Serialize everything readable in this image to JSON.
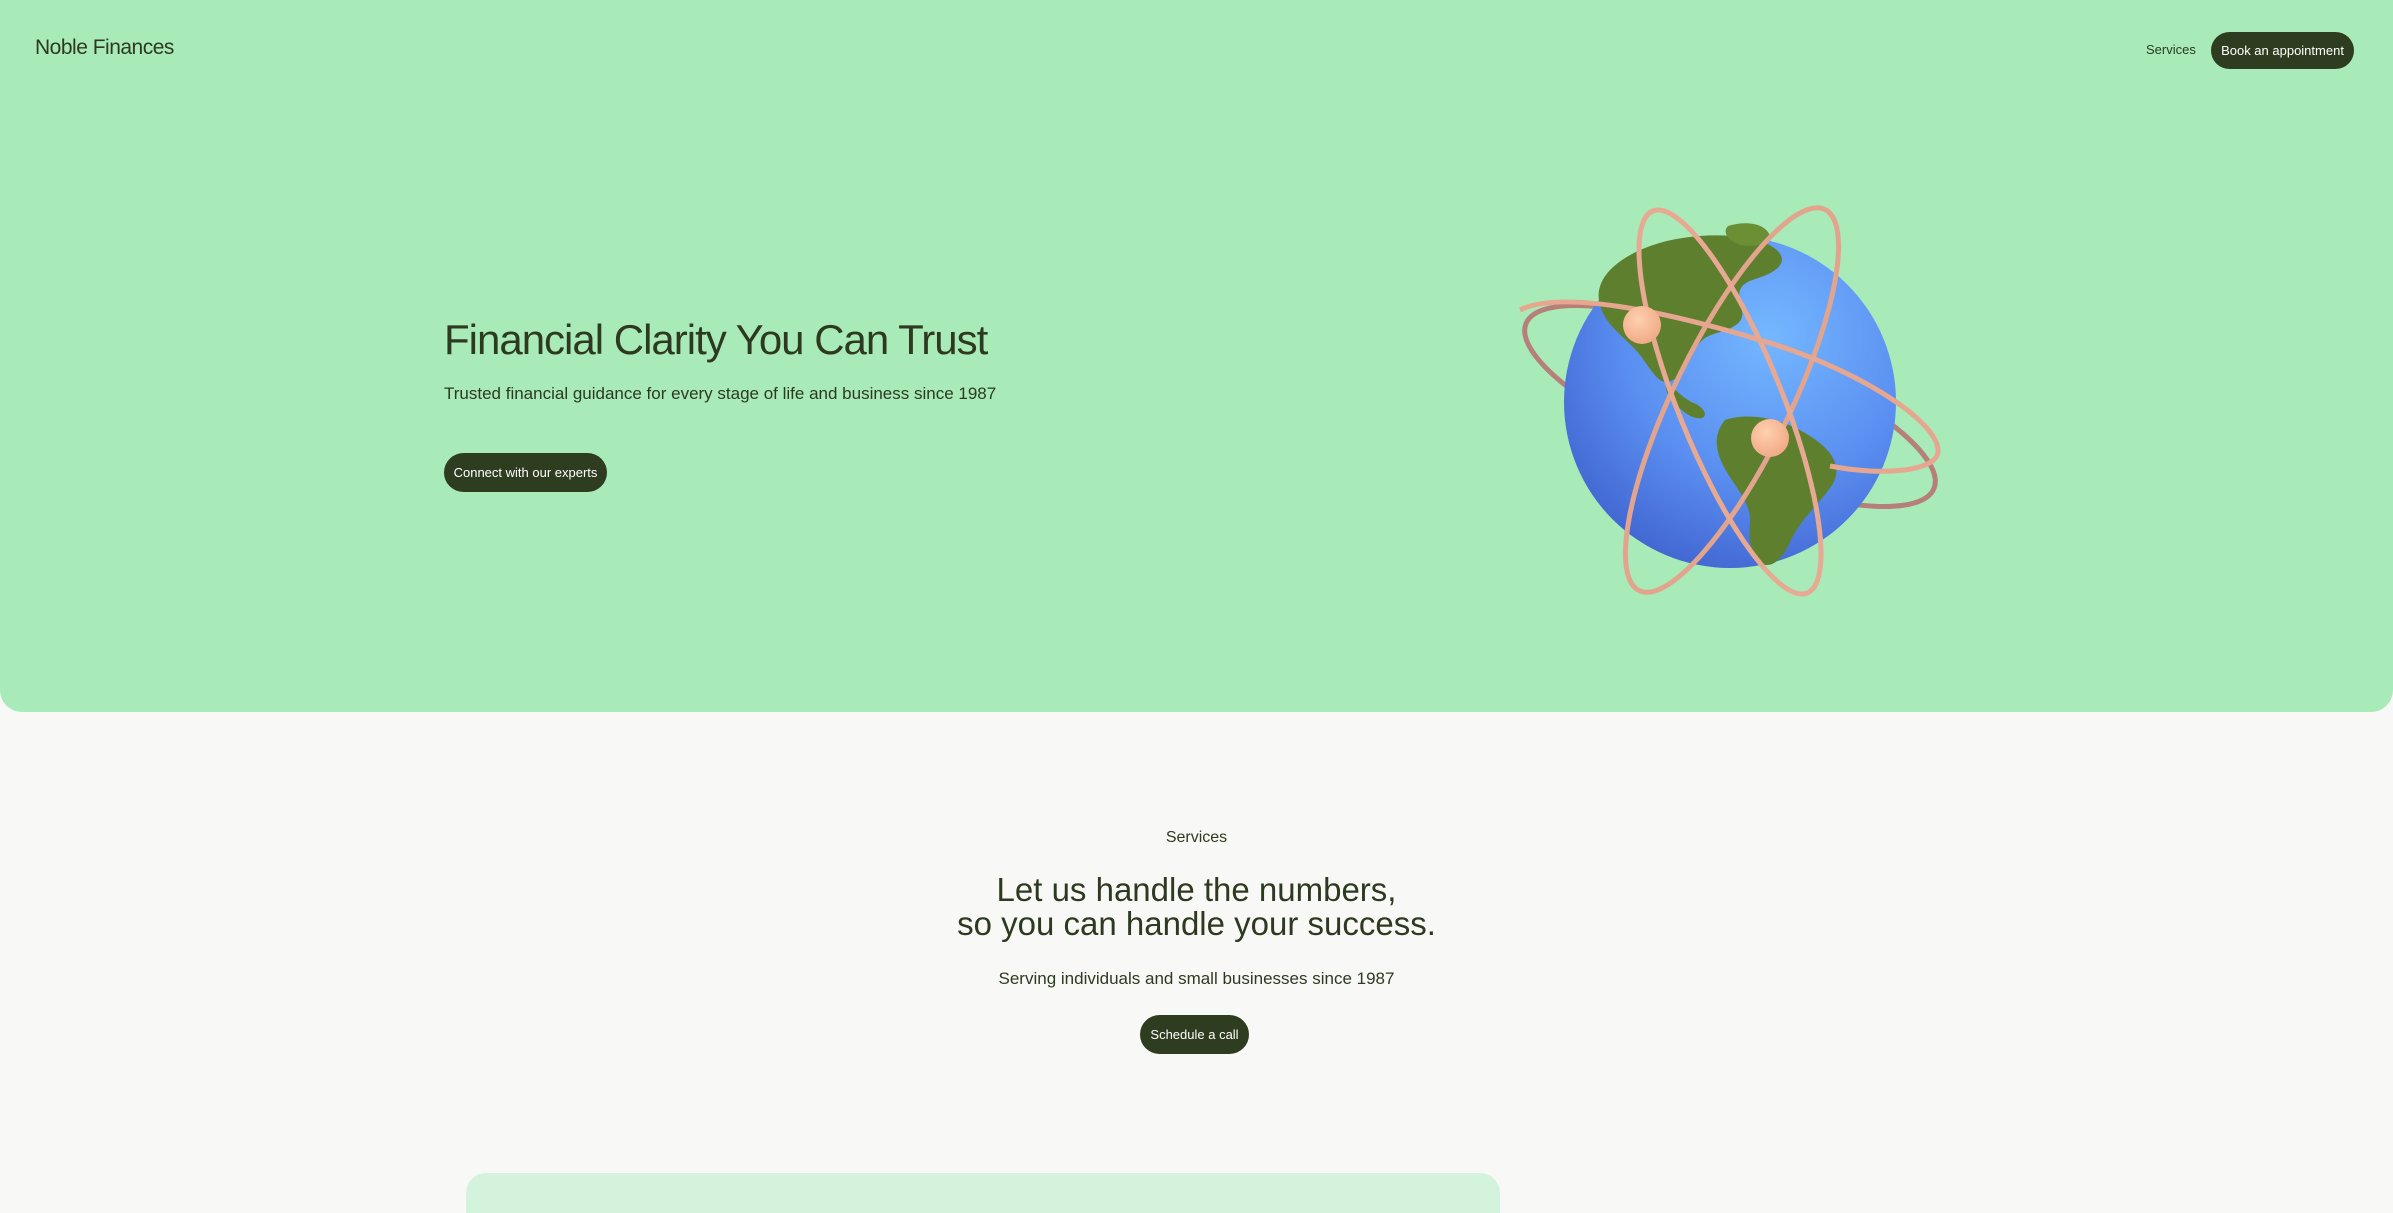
{
  "header": {
    "brand": "Noble Finances",
    "nav_services": "Services",
    "book_label": "Book an appointment"
  },
  "hero": {
    "title": "Financial Clarity You Can Trust",
    "subtitle": "Trusted financial guidance for every stage of life and business since 1987",
    "cta_label": "Connect with our experts",
    "illustration": "globe-with-orbits-illustration"
  },
  "services": {
    "eyebrow": "Services",
    "title_line1": "Let us handle the numbers,",
    "title_line2": "so you can handle your success.",
    "subtitle": "Serving individuals and small businesses since 1987",
    "cta_label": "Schedule a call"
  },
  "colors": {
    "hero_bg": "#a8ebb8",
    "page_bg": "#f8f8f7",
    "button_bg": "#2e3d1f",
    "text": "#2d3a20",
    "globe_blue": "#5b8df0",
    "land_green": "#5e7f2e",
    "orbit_peach": "#e3a48e"
  }
}
